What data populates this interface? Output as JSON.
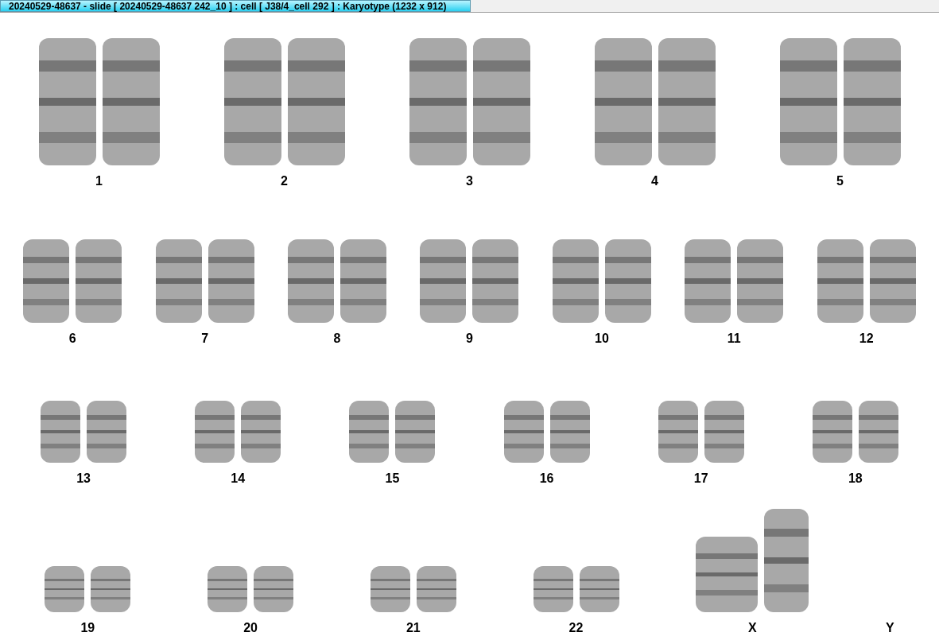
{
  "window": {
    "title": "20240529-48637 - slide [ 20240529-48637 242_10 ] : cell [ J38/4_cell 292 ] : Karyotype  (1232 x 912)"
  },
  "karyotype_rows": [
    {
      "chromosomes": [
        {
          "label": "1",
          "kind": "pair"
        },
        {
          "label": "2",
          "kind": "pair"
        },
        {
          "label": "3",
          "kind": "pair"
        },
        {
          "label": "4",
          "kind": "pair"
        },
        {
          "label": "5",
          "kind": "pair"
        }
      ]
    },
    {
      "chromosomes": [
        {
          "label": "6",
          "kind": "pair"
        },
        {
          "label": "7",
          "kind": "pair"
        },
        {
          "label": "8",
          "kind": "pair"
        },
        {
          "label": "9",
          "kind": "pair"
        },
        {
          "label": "10",
          "kind": "pair"
        },
        {
          "label": "11",
          "kind": "pair"
        },
        {
          "label": "12",
          "kind": "pair"
        }
      ]
    },
    {
      "chromosomes": [
        {
          "label": "13",
          "kind": "pair"
        },
        {
          "label": "14",
          "kind": "pair"
        },
        {
          "label": "15",
          "kind": "pair"
        },
        {
          "label": "16",
          "kind": "pair"
        },
        {
          "label": "17",
          "kind": "pair"
        },
        {
          "label": "18",
          "kind": "pair"
        }
      ]
    },
    {
      "chromosomes": [
        {
          "label": "19",
          "kind": "pair"
        },
        {
          "label": "20",
          "kind": "pair"
        },
        {
          "label": "21",
          "kind": "pair"
        },
        {
          "label": "22",
          "kind": "pair"
        },
        {
          "label": "X",
          "kind": "large-pair"
        },
        {
          "label": "Y",
          "kind": "absent"
        }
      ]
    }
  ]
}
